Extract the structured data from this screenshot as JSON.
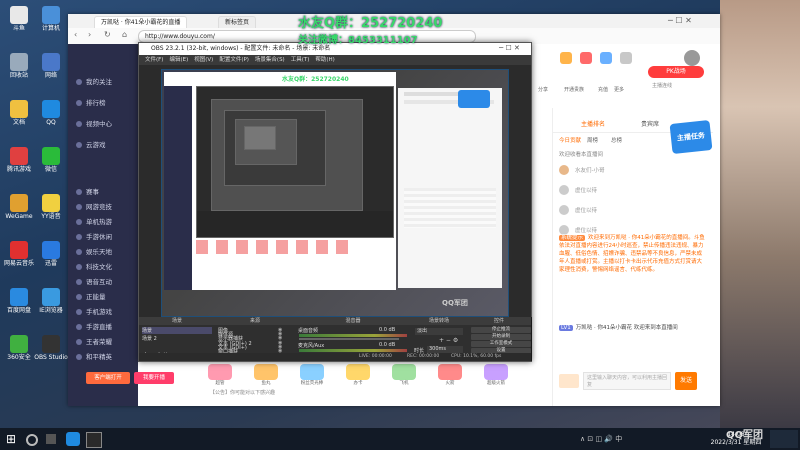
{
  "watermark": {
    "line1": "水友Q群：252720240",
    "line2": "关注微博：8453311107"
  },
  "desktop_icons": [
    {
      "label": "斗鱼",
      "color": "#e8e8e8"
    },
    {
      "label": "计算机",
      "color": "#4a90d9"
    },
    {
      "label": "回收站",
      "color": "#9ab"
    },
    {
      "label": "网络",
      "color": "#4a78c9"
    },
    {
      "label": "文档",
      "color": "#f0c040"
    },
    {
      "label": "QQ",
      "color": "#1f8ae0"
    },
    {
      "label": "腾讯游戏",
      "color": "#e04040"
    },
    {
      "label": "微信",
      "color": "#2abb3a"
    },
    {
      "label": "WeGame",
      "color": "#e0a030"
    },
    {
      "label": "YY语音",
      "color": "#f0d040"
    },
    {
      "label": "网易云音乐",
      "color": "#e03030"
    },
    {
      "label": "迅雷",
      "color": "#2a7ae0"
    },
    {
      "label": "百度网盘",
      "color": "#2a8ae0"
    },
    {
      "label": "IE浏览器",
      "color": "#3a9ae0"
    },
    {
      "label": "360安全",
      "color": "#40b040"
    },
    {
      "label": "OBS Studio",
      "color": "#333"
    }
  ],
  "browser": {
    "tabs": [
      "万凯哒 · 你41朵小霸花的直播",
      "新标签页"
    ],
    "url": "http://www.douyu.com/",
    "menu_buttons": [
      "最近",
      "关注",
      "分类",
      "直播",
      "更多"
    ]
  },
  "site_sidebar": {
    "items": [
      "我的关注",
      "排行榜",
      "视频中心",
      "云游戏",
      "赛事",
      "网游竞技",
      "单机热游",
      "手游休闲",
      "娱乐天地",
      "科技文化",
      "语音互动",
      "正能量",
      "手机游戏",
      "手游直播",
      "王者荣耀",
      "和平精英"
    ],
    "bottom_buttons": [
      "客户端打开",
      "我要开播"
    ]
  },
  "obs": {
    "title": "OBS 23.2.1 (32-bit, windows) - 配置文件: 未命名 - 场景: 未命名",
    "menu": [
      "文件(F)",
      "编辑(E)",
      "视图(V)",
      "配置文件(P)",
      "场景集合(S)",
      "工具(T)",
      "帮助(H)"
    ],
    "docks": {
      "scenes": {
        "title": "场景",
        "items": [
          "场景",
          "场景 2"
        ]
      },
      "sources": {
        "title": "来源",
        "items": [
          "图像",
          "媒体源",
          "显示器捕获",
          "文本 (GDI+) 2",
          "文本 (GDI+)",
          "窗口捕获"
        ]
      },
      "mixer": {
        "title": "混音器",
        "channels": [
          {
            "name": "桌面音频",
            "db": "0.0 dB"
          },
          {
            "name": "麦克风/Aux",
            "db": "0.0 dB"
          }
        ]
      },
      "transitions": {
        "title": "场景转场",
        "type": "淡出",
        "duration_label": "时长",
        "duration": "300ms"
      },
      "controls": {
        "title": "控件",
        "buttons": [
          "停止推流",
          "开始录制",
          "工作室模式",
          "设置",
          "退出"
        ]
      }
    },
    "status": {
      "live": "LIVE: 00:00:00",
      "rec": "REC: 00:00:00",
      "cpu": "CPU: 10.1%, 60.00 fps"
    }
  },
  "site_header": {
    "icons": [
      "关注",
      "历史",
      "消息",
      "客户端"
    ],
    "rank_buttons": [
      "分享",
      "开通贵族",
      "充值",
      "更多"
    ],
    "live_button": "PK战场",
    "live_sub": "主播连线"
  },
  "chat": {
    "tabs": [
      "主播排名",
      "贵宾席",
      "粉丝团"
    ],
    "subtabs": [
      "今日贡献",
      "周榜",
      "总榜"
    ],
    "task_badge": "主播任务",
    "rank_rows": [
      "欢迎收看本直播间",
      "水友们-小哥",
      "虚位以待",
      "虚位以待",
      "虚位以待"
    ],
    "messages": [
      {
        "tag": "系统提示",
        "text": "欢迎来到万凯哒 · 你41朵小霸花的直播间。斗鱼依法对直播内容进行24小时巡查，禁止传播违法违规、暴力血腥、低俗色情、招嫖诈骗、违禁品等不良信息，严禁未成年人直播或打赏。主播以打卡卡出示代币充值方式打赏请大家理性消费，警惕网络谣言、代练代练。"
      },
      {
        "tag": "LV1",
        "text": "万凯哒 · 你41朵小霸花  欢迎来到本直播间"
      }
    ],
    "input_placeholder": "这里输入聊天内容，可以利用主播回复",
    "send_label": "发送",
    "bottom_bar": [
      "超管",
      "鱼丸",
      "钻石",
      "礼物"
    ]
  },
  "gift_bar": {
    "items": [
      "超管",
      "鱼丸",
      "粉丝荧光棒",
      "办卡",
      "飞机",
      "火箭",
      "超级火箭"
    ],
    "level": "等级 LV1",
    "share": "分享",
    "note": "【公告】你可能对以下感兴趣"
  },
  "taskbar": {
    "time": "14:08",
    "date": "2022/3/31 星期四",
    "watermark": "QQ军团"
  }
}
